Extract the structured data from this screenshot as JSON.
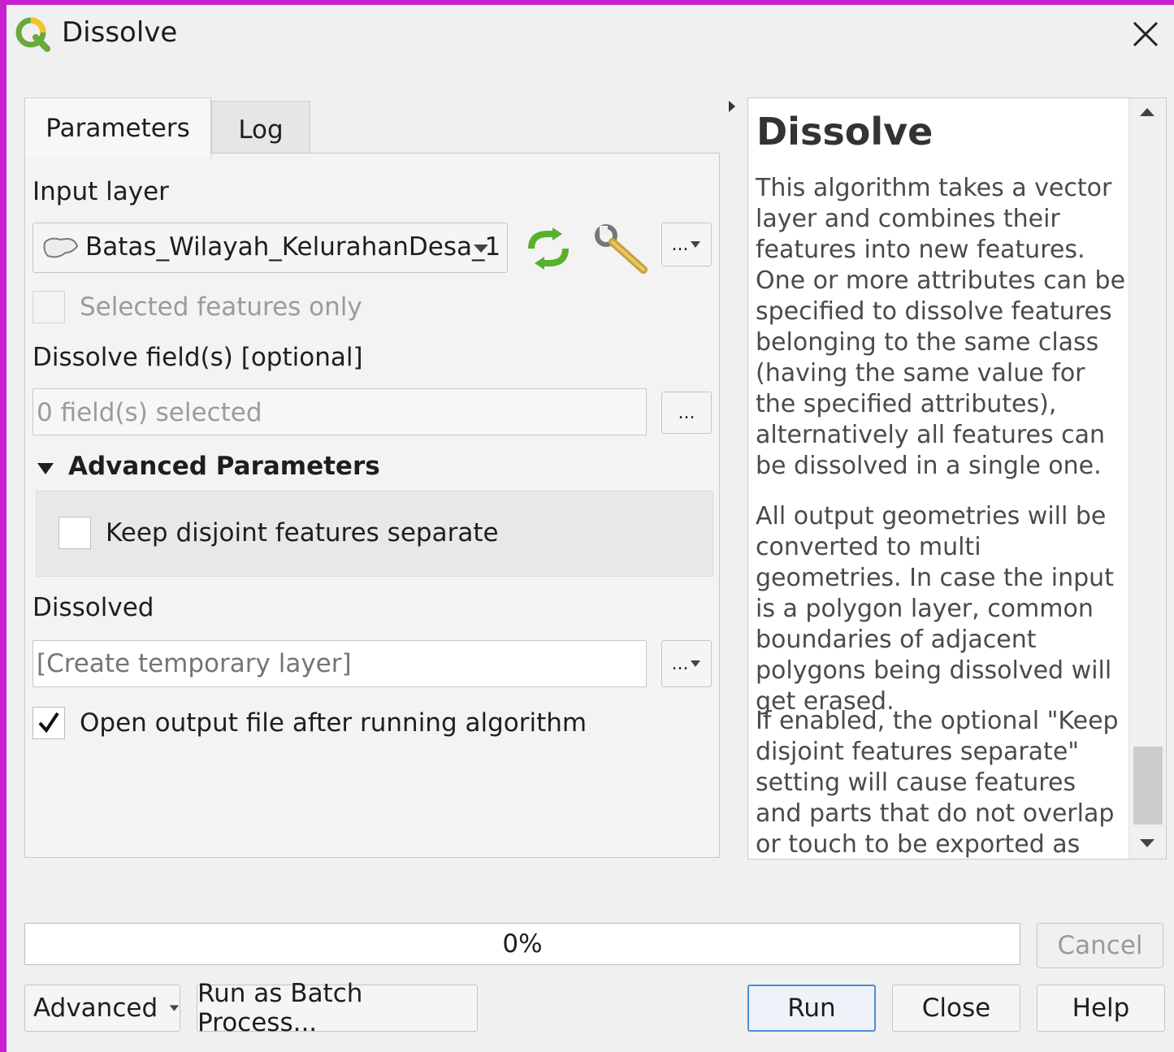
{
  "window": {
    "title": "Dissolve"
  },
  "tabs": [
    "Parameters",
    "Log"
  ],
  "input_layer": {
    "label": "Input layer",
    "value": "Batas_Wilayah_KelurahanDesa_1",
    "selected_only_label": "Selected features only",
    "ellipsis": "..."
  },
  "dissolve_fields": {
    "label": "Dissolve field(s) [optional]",
    "value": "0 field(s) selected",
    "button": "..."
  },
  "advanced_params": {
    "header": "Advanced Parameters",
    "keep_disjoint_label": "Keep disjoint features separate"
  },
  "output": {
    "label": "Dissolved",
    "placeholder": "[Create temporary layer]",
    "button": "...",
    "open_after_label": "Open output file after running algorithm"
  },
  "help": {
    "title": "Dissolve",
    "p1": "This algorithm takes a vector layer and combines their features into new features. One or more attributes can be specified to dissolve features belonging to the same class (having the same value for the specified attributes), alternatively all features can be dissolved in a single one.",
    "p2": "All output geometries will be converted to multi geometries. In case the input is a polygon layer, common boundaries of adjacent polygons being dissolved will get erased.",
    "p3": "If enabled, the optional \"Keep disjoint features separate\" setting will cause features and parts that do not overlap or touch to be exported as"
  },
  "progress": {
    "text": "0%",
    "value": 0
  },
  "buttons": {
    "cancel": "Cancel",
    "advanced": "Advanced",
    "batch": "Run as Batch Process...",
    "run": "Run",
    "close": "Close",
    "help": "Help"
  },
  "colors": {
    "accent": "#4b8fd6",
    "frame": "#c81fd0",
    "refresh_icon": "#58b02c"
  }
}
